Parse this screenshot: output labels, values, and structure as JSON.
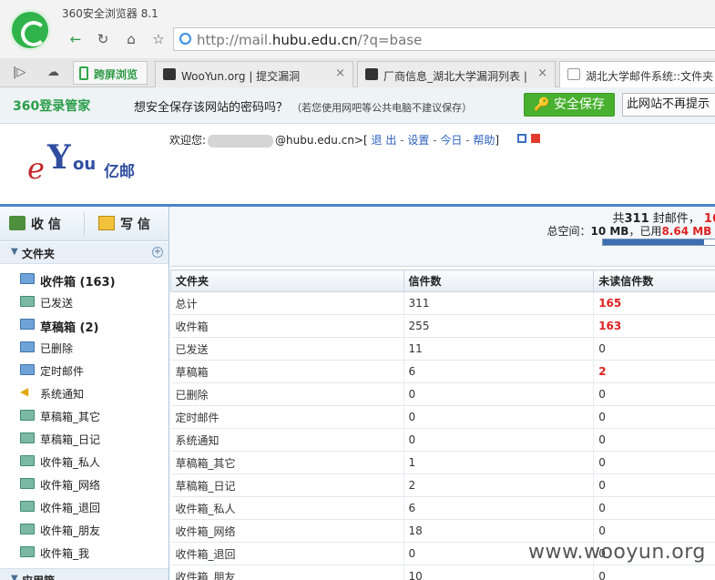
{
  "browser": {
    "title": "360安全浏览器 8.1",
    "address": {
      "prefix": "http://mail.",
      "domain": "hubu.edu.cn",
      "suffix": "/?q=base"
    },
    "nav": {
      "back": "←",
      "reload": "↻",
      "home": "⌂",
      "favorite": "☆"
    }
  },
  "tabbar": {
    "cross_label": "跨屏浏览",
    "tabs": [
      {
        "label": "WooYun.org | 提交漏洞",
        "close": "×"
      },
      {
        "label": "厂商信息_湖北大学漏洞列表 | W",
        "close": "×"
      },
      {
        "label": "湖北大学邮件系统::文件夹"
      }
    ]
  },
  "password_bar": {
    "brand": "360登录管家",
    "message": "想安全保存该网站的密码吗？",
    "hint": "（若您使用网吧等公共电脑不建议保存）",
    "save_label": "安全保存",
    "never_label": "此网站不再提示"
  },
  "header": {
    "logo_text": "亿邮",
    "welcome_prefix": "欢迎您:",
    "email_suffix": "@hubu.edu.cn>",
    "bracket_open": "[",
    "links": {
      "logout": "退 出",
      "settings": "设置",
      "today": "今日",
      "help": "帮助"
    },
    "bracket_close": "]",
    "sep": "-"
  },
  "sidebar": {
    "receive": "收 信",
    "compose": "写 信",
    "folders_head": "文件夹",
    "folders": [
      {
        "label": "收件箱 (163)",
        "bold": true
      },
      {
        "label": "已发送"
      },
      {
        "label": "草稿箱 (2)",
        "bold": true
      },
      {
        "label": "已删除"
      },
      {
        "label": "定时邮件"
      },
      {
        "label": "系统通知"
      },
      {
        "label": "草稿箱_其它"
      },
      {
        "label": "草稿箱_日记"
      },
      {
        "label": "收件箱_私人"
      },
      {
        "label": "收件箱_网络"
      },
      {
        "label": "收件箱_退回"
      },
      {
        "label": "收件箱_朋友"
      },
      {
        "label": "收件箱_我"
      }
    ],
    "apps_head": "应用箱"
  },
  "summary": {
    "line1_prefix": "共",
    "total_mails": "311",
    "line1_mid": " 封邮件， ",
    "unread_partial": "16",
    "line2_prefix": "总空间：",
    "space_total": "10 MB",
    "line2_mid": "，已用",
    "space_used": "8.64 MB (",
    "usage_fraction": 0.864
  },
  "table": {
    "headers": [
      "文件夹",
      "信件数",
      "未读信件数"
    ],
    "rows": [
      {
        "name": "总计",
        "count": "311",
        "unread": "165",
        "hot": true
      },
      {
        "name": "收件箱",
        "count": "255",
        "unread": "163",
        "hot": true
      },
      {
        "name": "已发送",
        "count": "11",
        "unread": "0"
      },
      {
        "name": "草稿箱",
        "count": "6",
        "unread": "2",
        "hot": true
      },
      {
        "name": "已删除",
        "count": "0",
        "unread": "0"
      },
      {
        "name": "定时邮件",
        "count": "0",
        "unread": "0"
      },
      {
        "name": "系统通知",
        "count": "0",
        "unread": "0"
      },
      {
        "name": "草稿箱_其它",
        "count": "1",
        "unread": "0"
      },
      {
        "name": "草稿箱_日记",
        "count": "2",
        "unread": "0"
      },
      {
        "name": "收件箱_私人",
        "count": "6",
        "unread": "0"
      },
      {
        "name": "收件箱_网络",
        "count": "18",
        "unread": "0"
      },
      {
        "name": "收件箱_退回",
        "count": "0",
        "unread": "0"
      },
      {
        "name": "收件箱_朋友",
        "count": "10",
        "unread": "0"
      }
    ]
  },
  "watermark": "www.wooyun.org",
  "colors": {
    "accent": "#4a84c4",
    "alert": "#d22222",
    "brand_green": "#49b030"
  }
}
